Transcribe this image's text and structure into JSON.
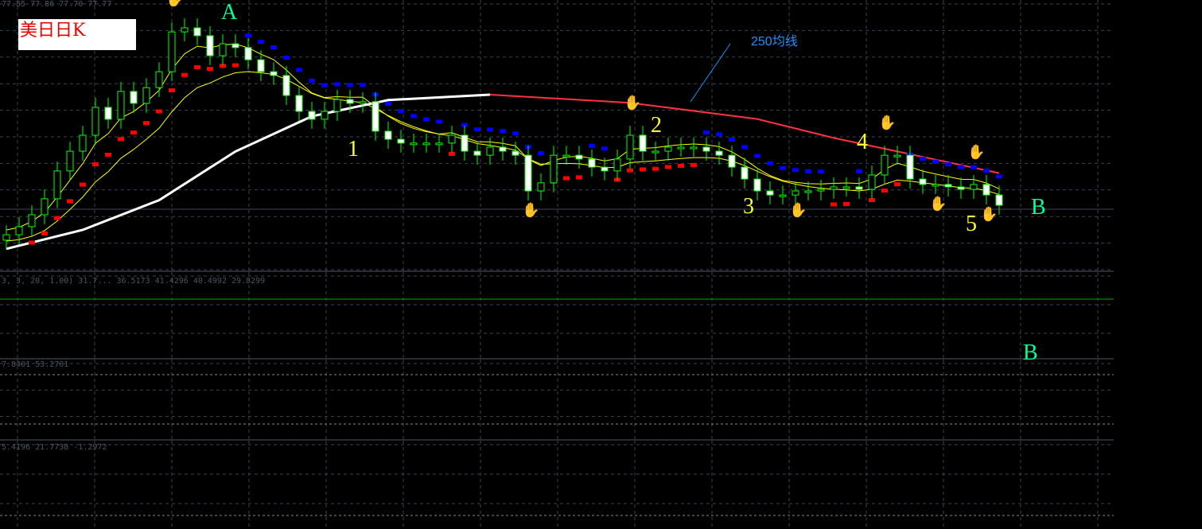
{
  "title_box": "美日日K",
  "ohlc_header": "77.85 77.86 77.70 77.77",
  "ma_annotation": "250均线",
  "labels": {
    "A": "A",
    "one": "1",
    "two": "2",
    "three": "3",
    "four": "4",
    "five": "5",
    "B1": "B",
    "B2": "B"
  },
  "panes": {
    "macd_header": "3, 3, 20, 1.00) 31.7... 36.5173 41.4296 40.4992 29.8299",
    "stoch_header": "7.8401 53.2701",
    "osc_header": "5.4196 21.7738 -1.2972"
  },
  "colors": {
    "bull": "#00ff00",
    "bear": "#ffffff",
    "ma_fast": "#ffff00",
    "ma250_up": "#ffffff",
    "ma250_down": "#ff3040",
    "sar_up": "#ff0000",
    "sar_down": "#0000ff",
    "grid": "#3a4450",
    "accent_label": "#00ff99",
    "num_label": "#ffff33"
  },
  "chart_data": {
    "type": "candlestick",
    "title": "美日日K",
    "ylim": [
      70,
      80
    ],
    "closes": [
      71.32,
      71.62,
      72.06,
      72.65,
      73.68,
      74.41,
      75.0,
      76.03,
      75.59,
      76.62,
      76.18,
      76.76,
      77.35,
      78.82,
      78.97,
      78.68,
      77.94,
      78.38,
      78.24,
      77.79,
      77.35,
      77.21,
      76.47,
      75.88,
      75.59,
      75.88,
      76.32,
      76.18,
      76.24,
      75.15,
      74.85,
      74.71,
      74.71,
      74.71,
      74.71,
      75.0,
      74.41,
      74.26,
      74.56,
      74.41,
      74.26,
      72.94,
      73.24,
      74.26,
      74.26,
      74.12,
      73.82,
      73.68,
      74.12,
      75.0,
      74.41,
      74.41,
      74.56,
      74.56,
      74.56,
      74.41,
      74.26,
      73.82,
      73.38,
      72.94,
      72.79,
      72.79,
      72.94,
      72.94,
      73.0,
      73.09,
      73.09,
      73.0,
      73.53,
      74.26,
      74.26,
      73.38,
      73.18,
      73.18,
      73.09,
      73.0,
      73.18,
      72.79,
      72.41
    ],
    "ma250": [
      [
        0,
        70.8
      ],
      [
        6,
        71.5
      ],
      [
        12,
        72.6
      ],
      [
        18,
        74.4
      ],
      [
        24,
        75.7
      ],
      [
        30,
        76.3
      ],
      [
        38,
        76.5
      ],
      [
        49,
        76.2
      ],
      [
        59,
        75.6
      ],
      [
        65,
        74.9
      ],
      [
        71,
        74.3
      ],
      [
        78,
        73.6
      ]
    ],
    "ma250_turn_index": 38,
    "signals": [
      {
        "index": 13,
        "type": "top"
      },
      {
        "index": 41,
        "type": "bottom"
      },
      {
        "index": 49,
        "type": "top"
      },
      {
        "index": 62,
        "type": "bottom"
      },
      {
        "index": 69,
        "type": "top"
      },
      {
        "index": 73,
        "type": "bottom"
      },
      {
        "index": 76,
        "type": "top"
      },
      {
        "index": 77,
        "type": "bottom"
      }
    ]
  }
}
